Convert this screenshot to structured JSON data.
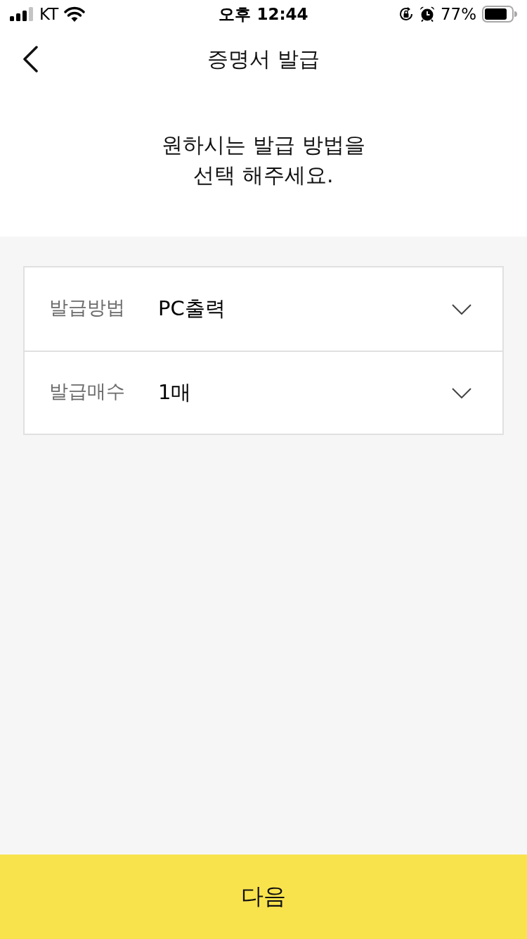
{
  "status_bar": {
    "carrier": "KT",
    "time": "오후 12:44",
    "battery": "77%"
  },
  "nav": {
    "title": "증명서 발급"
  },
  "prompt": "원하시는 발급 방법을\n선택 해주세요.",
  "fields": [
    {
      "label": "발급방법",
      "value": "PC출력"
    },
    {
      "label": "발급매수",
      "value": "1매"
    }
  ],
  "next_button": {
    "label": "다음"
  }
}
